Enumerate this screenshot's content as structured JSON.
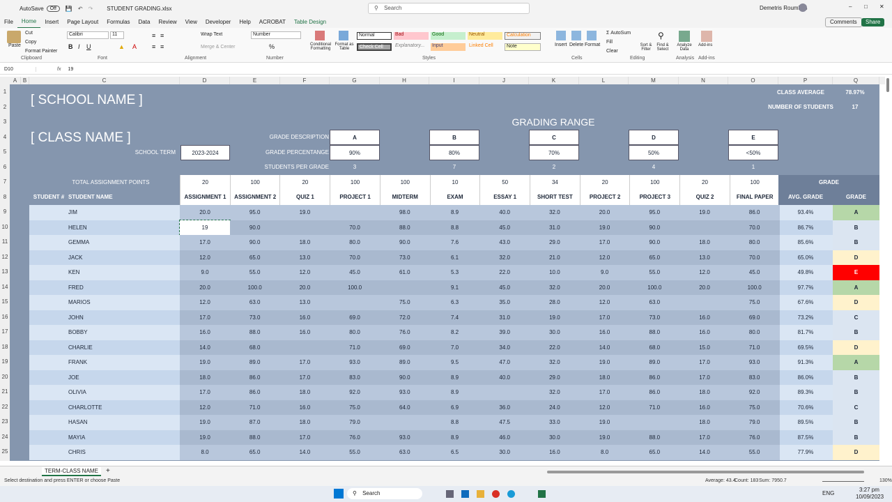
{
  "title": {
    "autosave": "AutoSave",
    "toggle": "Off",
    "filename": "STUDENT GRADING.xlsx",
    "search": "Search",
    "user": "Demetris Roumbas"
  },
  "menu": [
    "File",
    "Home",
    "Insert",
    "Page Layout",
    "Formulas",
    "Data",
    "Review",
    "View",
    "Developer",
    "Help",
    "ACROBAT",
    "Table Design"
  ],
  "menu_right": {
    "comments": "Comments",
    "share": "Share"
  },
  "ribbon": {
    "clipboard": {
      "paste": "Paste",
      "cut": "Cut",
      "copy": "Copy",
      "format_painter": "Format Painter",
      "label": "Clipboard"
    },
    "font": {
      "name": "Calibri",
      "size": "11",
      "label": "Font"
    },
    "alignment": {
      "wrap": "Wrap Text",
      "merge": "Merge & Center",
      "label": "Alignment"
    },
    "number": {
      "format": "Number",
      "label": "Number"
    },
    "styles": {
      "conditional": "Conditional Formatting",
      "format_table": "Format as Table",
      "normal": "Normal",
      "bad": "Bad",
      "good": "Good",
      "neutral": "Neutral",
      "calculation": "Calculation",
      "check_cell": "Check Cell",
      "explanatory": "Explanatory...",
      "input": "Input",
      "linked_cell": "Linked Cell",
      "note": "Note",
      "label": "Styles"
    },
    "cells": {
      "insert": "Insert",
      "delete": "Delete",
      "format": "Format",
      "label": "Cells"
    },
    "editing": {
      "autosum": "AutoSum",
      "fill": "Fill",
      "clear": "Clear",
      "sort": "Sort & Filter",
      "find": "Find & Select",
      "label": "Editing"
    },
    "analysis": {
      "analyze": "Analyze Data",
      "label": "Analysis"
    },
    "addins": {
      "addins": "Add-ins",
      "label": "Add-ins"
    }
  },
  "formula": {
    "namebox": "D10",
    "fx": "fx",
    "value": "19"
  },
  "columns": [
    "A",
    "B",
    "C",
    "D",
    "E",
    "F",
    "G",
    "H",
    "I",
    "J",
    "K",
    "L",
    "M",
    "N",
    "O",
    "P",
    "Q"
  ],
  "rows": [
    "1",
    "2",
    "3",
    "4",
    "5",
    "6",
    "7",
    "8",
    "9",
    "10",
    "11",
    "12",
    "13",
    "14",
    "15",
    "16",
    "17",
    "18",
    "19",
    "20",
    "21",
    "22",
    "23",
    "24",
    "25"
  ],
  "sheet": {
    "school": "[ SCHOOL NAME ]",
    "class": "[ CLASS NAME ]",
    "class_avg_label": "CLASS AVERAGE",
    "class_avg": "78.97%",
    "num_students_label": "NUMBER OF STUDENTS",
    "num_students": "17",
    "grading_range": "GRADING RANGE",
    "grade_desc_label": "GRADE DESCRIPTION",
    "grade_pct_label": "GRADE PERCENTANGE",
    "students_per_grade_label": "STUDENTS PER GRADE",
    "school_term_label": "SCHOOL TERM",
    "school_term": "2023-2024",
    "grades": [
      {
        "letter": "A",
        "pct": "90%",
        "count": "3"
      },
      {
        "letter": "B",
        "pct": "80%",
        "count": "7"
      },
      {
        "letter": "C",
        "pct": "70%",
        "count": "2"
      },
      {
        "letter": "D",
        "pct": "50%",
        "count": "4"
      },
      {
        "letter": "E",
        "pct": "<50%",
        "count": "1"
      }
    ],
    "total_points_label": "TOTAL ASSIGNMENT POINTS",
    "points": [
      "20",
      "100",
      "20",
      "100",
      "100",
      "10",
      "50",
      "34",
      "20",
      "100",
      "20",
      "100"
    ],
    "student_num_label": "STUDENT #",
    "student_name_label": "STUDENT NAME",
    "assignments": [
      "ASSIGNMENT 1",
      "ASSIGNMENT 2",
      "QUIZ 1",
      "PROJECT 1",
      "MIDTERM",
      "EXAM",
      "ESSAY 1",
      "SHORT TEST",
      "PROJECT 2",
      "PROJECT 3",
      "QUIZ 2",
      "FINAL PAPER"
    ],
    "grade_header": "GRADE",
    "avg_grade_label": "AVG. GRADE",
    "grade_label": "GRADE",
    "students": [
      {
        "name": "JIM",
        "scores": [
          "20.0",
          "95.0",
          "19.0",
          "",
          "98.0",
          "8.9",
          "40.0",
          "32.0",
          "20.0",
          "95.0",
          "19.0",
          "86.0"
        ],
        "avg": "93.4%",
        "grade": "A"
      },
      {
        "name": "HELEN",
        "scores": [
          "19",
          "90.0",
          "",
          "70.0",
          "88.0",
          "8.8",
          "45.0",
          "31.0",
          "19.0",
          "90.0",
          "",
          "70.0"
        ],
        "avg": "86.7%",
        "grade": "B"
      },
      {
        "name": "GEMMA",
        "scores": [
          "17.0",
          "90.0",
          "18.0",
          "80.0",
          "90.0",
          "7.6",
          "43.0",
          "29.0",
          "17.0",
          "90.0",
          "18.0",
          "80.0"
        ],
        "avg": "85.6%",
        "grade": "B"
      },
      {
        "name": "JACK",
        "scores": [
          "12.0",
          "65.0",
          "13.0",
          "70.0",
          "73.0",
          "6.1",
          "32.0",
          "21.0",
          "12.0",
          "65.0",
          "13.0",
          "70.0"
        ],
        "avg": "65.0%",
        "grade": "D"
      },
      {
        "name": "KEN",
        "scores": [
          "9.0",
          "55.0",
          "12.0",
          "45.0",
          "61.0",
          "5.3",
          "22.0",
          "10.0",
          "9.0",
          "55.0",
          "12.0",
          "45.0"
        ],
        "avg": "49.8%",
        "grade": "E"
      },
      {
        "name": "FRED",
        "scores": [
          "20.0",
          "100.0",
          "20.0",
          "100.0",
          "",
          "9.1",
          "45.0",
          "32.0",
          "20.0",
          "100.0",
          "20.0",
          "100.0"
        ],
        "avg": "97.7%",
        "grade": "A"
      },
      {
        "name": "MARIOS",
        "scores": [
          "12.0",
          "63.0",
          "13.0",
          "",
          "75.0",
          "6.3",
          "35.0",
          "28.0",
          "12.0",
          "63.0",
          "",
          "75.0"
        ],
        "avg": "67.6%",
        "grade": "D"
      },
      {
        "name": "JOHN",
        "scores": [
          "17.0",
          "73.0",
          "16.0",
          "69.0",
          "72.0",
          "7.4",
          "31.0",
          "19.0",
          "17.0",
          "73.0",
          "16.0",
          "69.0"
        ],
        "avg": "73.2%",
        "grade": "C"
      },
      {
        "name": "BOBBY",
        "scores": [
          "16.0",
          "88.0",
          "16.0",
          "80.0",
          "76.0",
          "8.2",
          "39.0",
          "30.0",
          "16.0",
          "88.0",
          "16.0",
          "80.0"
        ],
        "avg": "81.7%",
        "grade": "B"
      },
      {
        "name": "CHARLIE",
        "scores": [
          "14.0",
          "68.0",
          "",
          "71.0",
          "69.0",
          "7.0",
          "34.0",
          "22.0",
          "14.0",
          "68.0",
          "15.0",
          "71.0"
        ],
        "avg": "69.5%",
        "grade": "D"
      },
      {
        "name": "FRANK",
        "scores": [
          "19.0",
          "89.0",
          "17.0",
          "93.0",
          "89.0",
          "9.5",
          "47.0",
          "32.0",
          "19.0",
          "89.0",
          "17.0",
          "93.0"
        ],
        "avg": "91.3%",
        "grade": "A"
      },
      {
        "name": "JOE",
        "scores": [
          "18.0",
          "86.0",
          "17.0",
          "83.0",
          "90.0",
          "8.9",
          "40.0",
          "29.0",
          "18.0",
          "86.0",
          "17.0",
          "83.0"
        ],
        "avg": "86.0%",
        "grade": "B"
      },
      {
        "name": "OLIVIA",
        "scores": [
          "17.0",
          "86.0",
          "18.0",
          "92.0",
          "93.0",
          "8.9",
          "",
          "32.0",
          "17.0",
          "86.0",
          "18.0",
          "92.0"
        ],
        "avg": "89.3%",
        "grade": "B"
      },
      {
        "name": "CHARLOTTE",
        "scores": [
          "12.0",
          "71.0",
          "16.0",
          "75.0",
          "64.0",
          "6.9",
          "36.0",
          "24.0",
          "12.0",
          "71.0",
          "16.0",
          "75.0"
        ],
        "avg": "70.6%",
        "grade": "C"
      },
      {
        "name": "HASAN",
        "scores": [
          "19.0",
          "87.0",
          "18.0",
          "79.0",
          "",
          "8.8",
          "47.5",
          "33.0",
          "19.0",
          "",
          "18.0",
          "79.0"
        ],
        "avg": "89.5%",
        "grade": "B"
      },
      {
        "name": "MAYIA",
        "scores": [
          "19.0",
          "88.0",
          "17.0",
          "76.0",
          "93.0",
          "8.9",
          "46.0",
          "30.0",
          "19.0",
          "88.0",
          "17.0",
          "76.0"
        ],
        "avg": "87.5%",
        "grade": "B"
      },
      {
        "name": "CHRIS",
        "scores": [
          "8.0",
          "65.0",
          "14.0",
          "55.0",
          "63.0",
          "6.5",
          "30.0",
          "16.0",
          "8.0",
          "65.0",
          "14.0",
          "55.0"
        ],
        "avg": "77.9%",
        "grade": "D"
      }
    ]
  },
  "grade_colors": {
    "A": "#b6d7a8",
    "B": "#dbe5f1",
    "C": "#dbe5f1",
    "D": "#fff2cc",
    "E": "#ff0000"
  },
  "tabs": {
    "sheet": "TERM-CLASS NAME",
    "add": "+"
  },
  "status": {
    "message": "Select destination and press ENTER or choose Paste",
    "average": "Average: 43.4",
    "count": "Count: 183",
    "sum": "Sum: 7950.7",
    "zoom": "130%"
  },
  "taskbar": {
    "search": "Search",
    "lang": "ENG",
    "time": "3:27 pm",
    "date": "10/09/2023"
  }
}
